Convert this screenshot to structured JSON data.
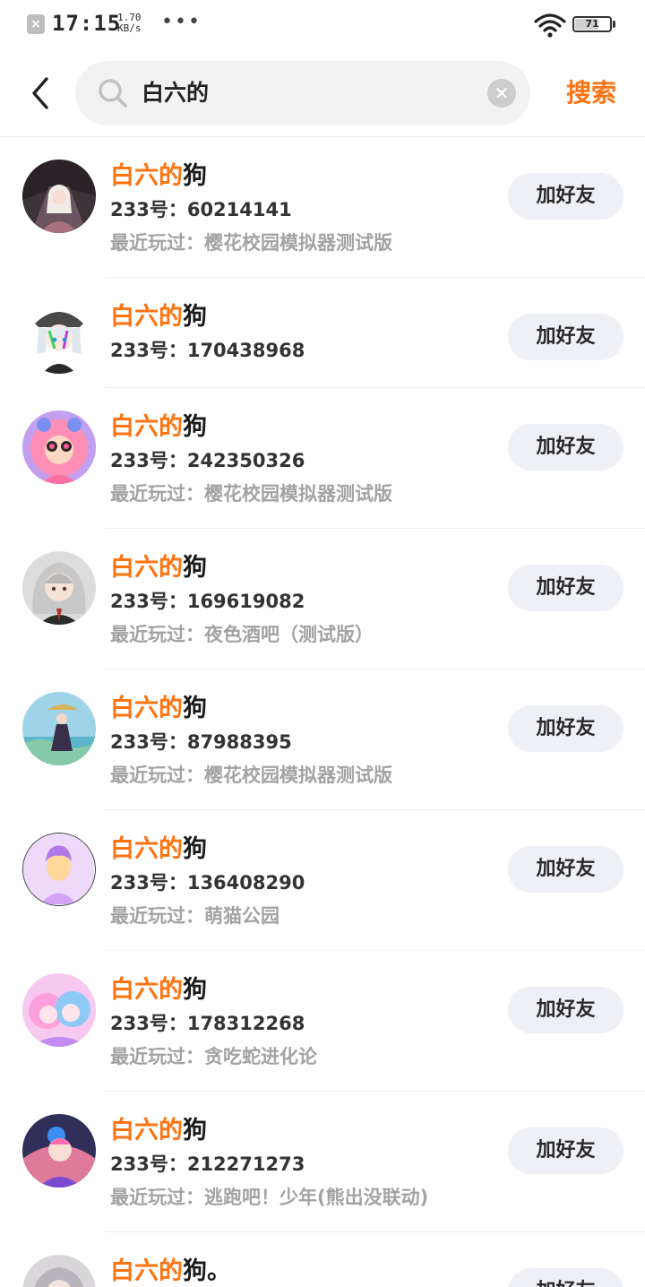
{
  "status_bar": {
    "notification_icon": "x-box-icon",
    "time": "17:15",
    "net_speed_value": "1.70",
    "net_speed_unit": "KB/s",
    "more": "•••",
    "battery": "71"
  },
  "header": {
    "back_icon": "chevron-left-icon",
    "search_query": "白六的",
    "clear_icon": "clear-icon",
    "search_label": "搜索"
  },
  "colors": {
    "accent": "#ff7310",
    "button_bg": "#eef0f5",
    "muted_text": "#a3a3a3"
  },
  "results": [
    {
      "highlight": "白六的",
      "rest": "狗",
      "uid": "233号：60214141",
      "played": "最近玩过：樱花校园模拟器测试版",
      "button": "加好友"
    },
    {
      "highlight": "白六的",
      "rest": "狗",
      "uid": "233号：170438968",
      "played": "",
      "button": "加好友"
    },
    {
      "highlight": "白六的",
      "rest": "狗",
      "uid": "233号：242350326",
      "played": "最近玩过：樱花校园模拟器测试版",
      "button": "加好友"
    },
    {
      "highlight": "白六的",
      "rest": "狗",
      "uid": "233号：169619082",
      "played": "最近玩过：夜色酒吧（测试版）",
      "button": "加好友"
    },
    {
      "highlight": "白六的",
      "rest": "狗",
      "uid": "233号：87988395",
      "played": "最近玩过：樱花校园模拟器测试版",
      "button": "加好友"
    },
    {
      "highlight": "白六的",
      "rest": "狗",
      "uid": "233号：136408290",
      "played": "最近玩过：萌猫公园",
      "button": "加好友"
    },
    {
      "highlight": "白六的",
      "rest": "狗",
      "uid": "233号：178312268",
      "played": "最近玩过：贪吃蛇进化论",
      "button": "加好友"
    },
    {
      "highlight": "白六的",
      "rest": "狗",
      "uid": "233号：212271273",
      "played": "最近玩过：逃跑吧！少年(熊出没联动)",
      "button": "加好友"
    },
    {
      "highlight": "白六的",
      "rest": "狗。",
      "uid": "",
      "played": "",
      "button": "加好友"
    }
  ]
}
